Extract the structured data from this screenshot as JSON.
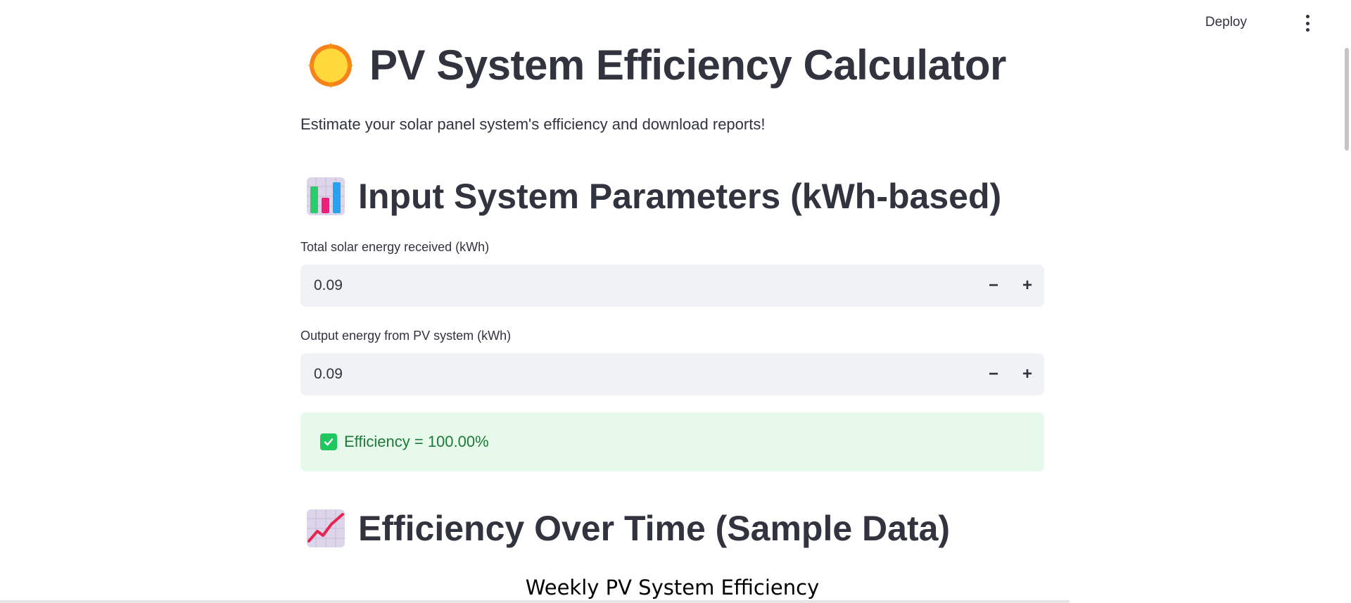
{
  "toolbar": {
    "deploy_label": "Deploy",
    "menu_icon": "more-vertical-icon"
  },
  "header": {
    "title": "PV System Efficiency Calculator",
    "title_icon": "sun-emoji-icon",
    "subtitle": "Estimate your solar panel system's efficiency and download reports!"
  },
  "inputs_section": {
    "title": "Input System Parameters (kWh-based)",
    "icon": "bar-chart-emoji-icon",
    "fields": [
      {
        "label": "Total solar energy received (kWh)",
        "value": "0.09",
        "decrement": "−",
        "increment": "+"
      },
      {
        "label": "Output energy from PV system (kWh)",
        "value": "0.09",
        "decrement": "−",
        "increment": "+"
      }
    ]
  },
  "result": {
    "text": "Efficiency = 100.00%",
    "icon": "check-box-icon",
    "color": "#1fc75f"
  },
  "chart_section": {
    "title": "Efficiency Over Time (Sample Data)",
    "icon": "chart-increasing-emoji-icon",
    "chart_title": "Weekly PV System Efficiency"
  }
}
